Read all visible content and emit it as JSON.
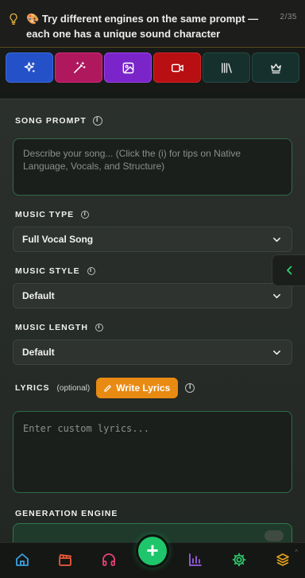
{
  "tip": {
    "emoji": "🎨",
    "text": "Try different engines on the same prompt — each one has a unique sound character",
    "counter": "2/35"
  },
  "modes": [
    {
      "name": "sparkles",
      "color": "#2451c7"
    },
    {
      "name": "magic-wand",
      "color": "#b0185e"
    },
    {
      "name": "image",
      "color": "#7a24c9"
    },
    {
      "name": "video",
      "color": "#b70f12"
    },
    {
      "name": "library",
      "color": "#15302d"
    },
    {
      "name": "crown",
      "color": "#15302d"
    }
  ],
  "form": {
    "song_prompt": {
      "label": "SONG PROMPT",
      "placeholder": "Describe your song... (Click the (i) for tips on Native Language, Vocals, and Structure)"
    },
    "music_type": {
      "label": "MUSIC TYPE",
      "value": "Full Vocal Song"
    },
    "music_style": {
      "label": "MUSIC STYLE",
      "value": "Default"
    },
    "music_length": {
      "label": "MUSIC LENGTH",
      "value": "Default"
    },
    "lyrics": {
      "label": "LYRICS",
      "optional": "(optional)",
      "write_button": "Write Lyrics",
      "placeholder": "Enter custom lyrics..."
    },
    "generation_engine": {
      "label": "GENERATION ENGINE"
    }
  },
  "bottom_nav": {
    "items": [
      "home",
      "clapperboard",
      "headphones",
      "create",
      "chart",
      "settings",
      "layers"
    ],
    "fab_label": "+"
  },
  "colors": {
    "accent_green": "#1fc56a",
    "write_button": "#e98a12",
    "border_green": "#2f6b46"
  }
}
